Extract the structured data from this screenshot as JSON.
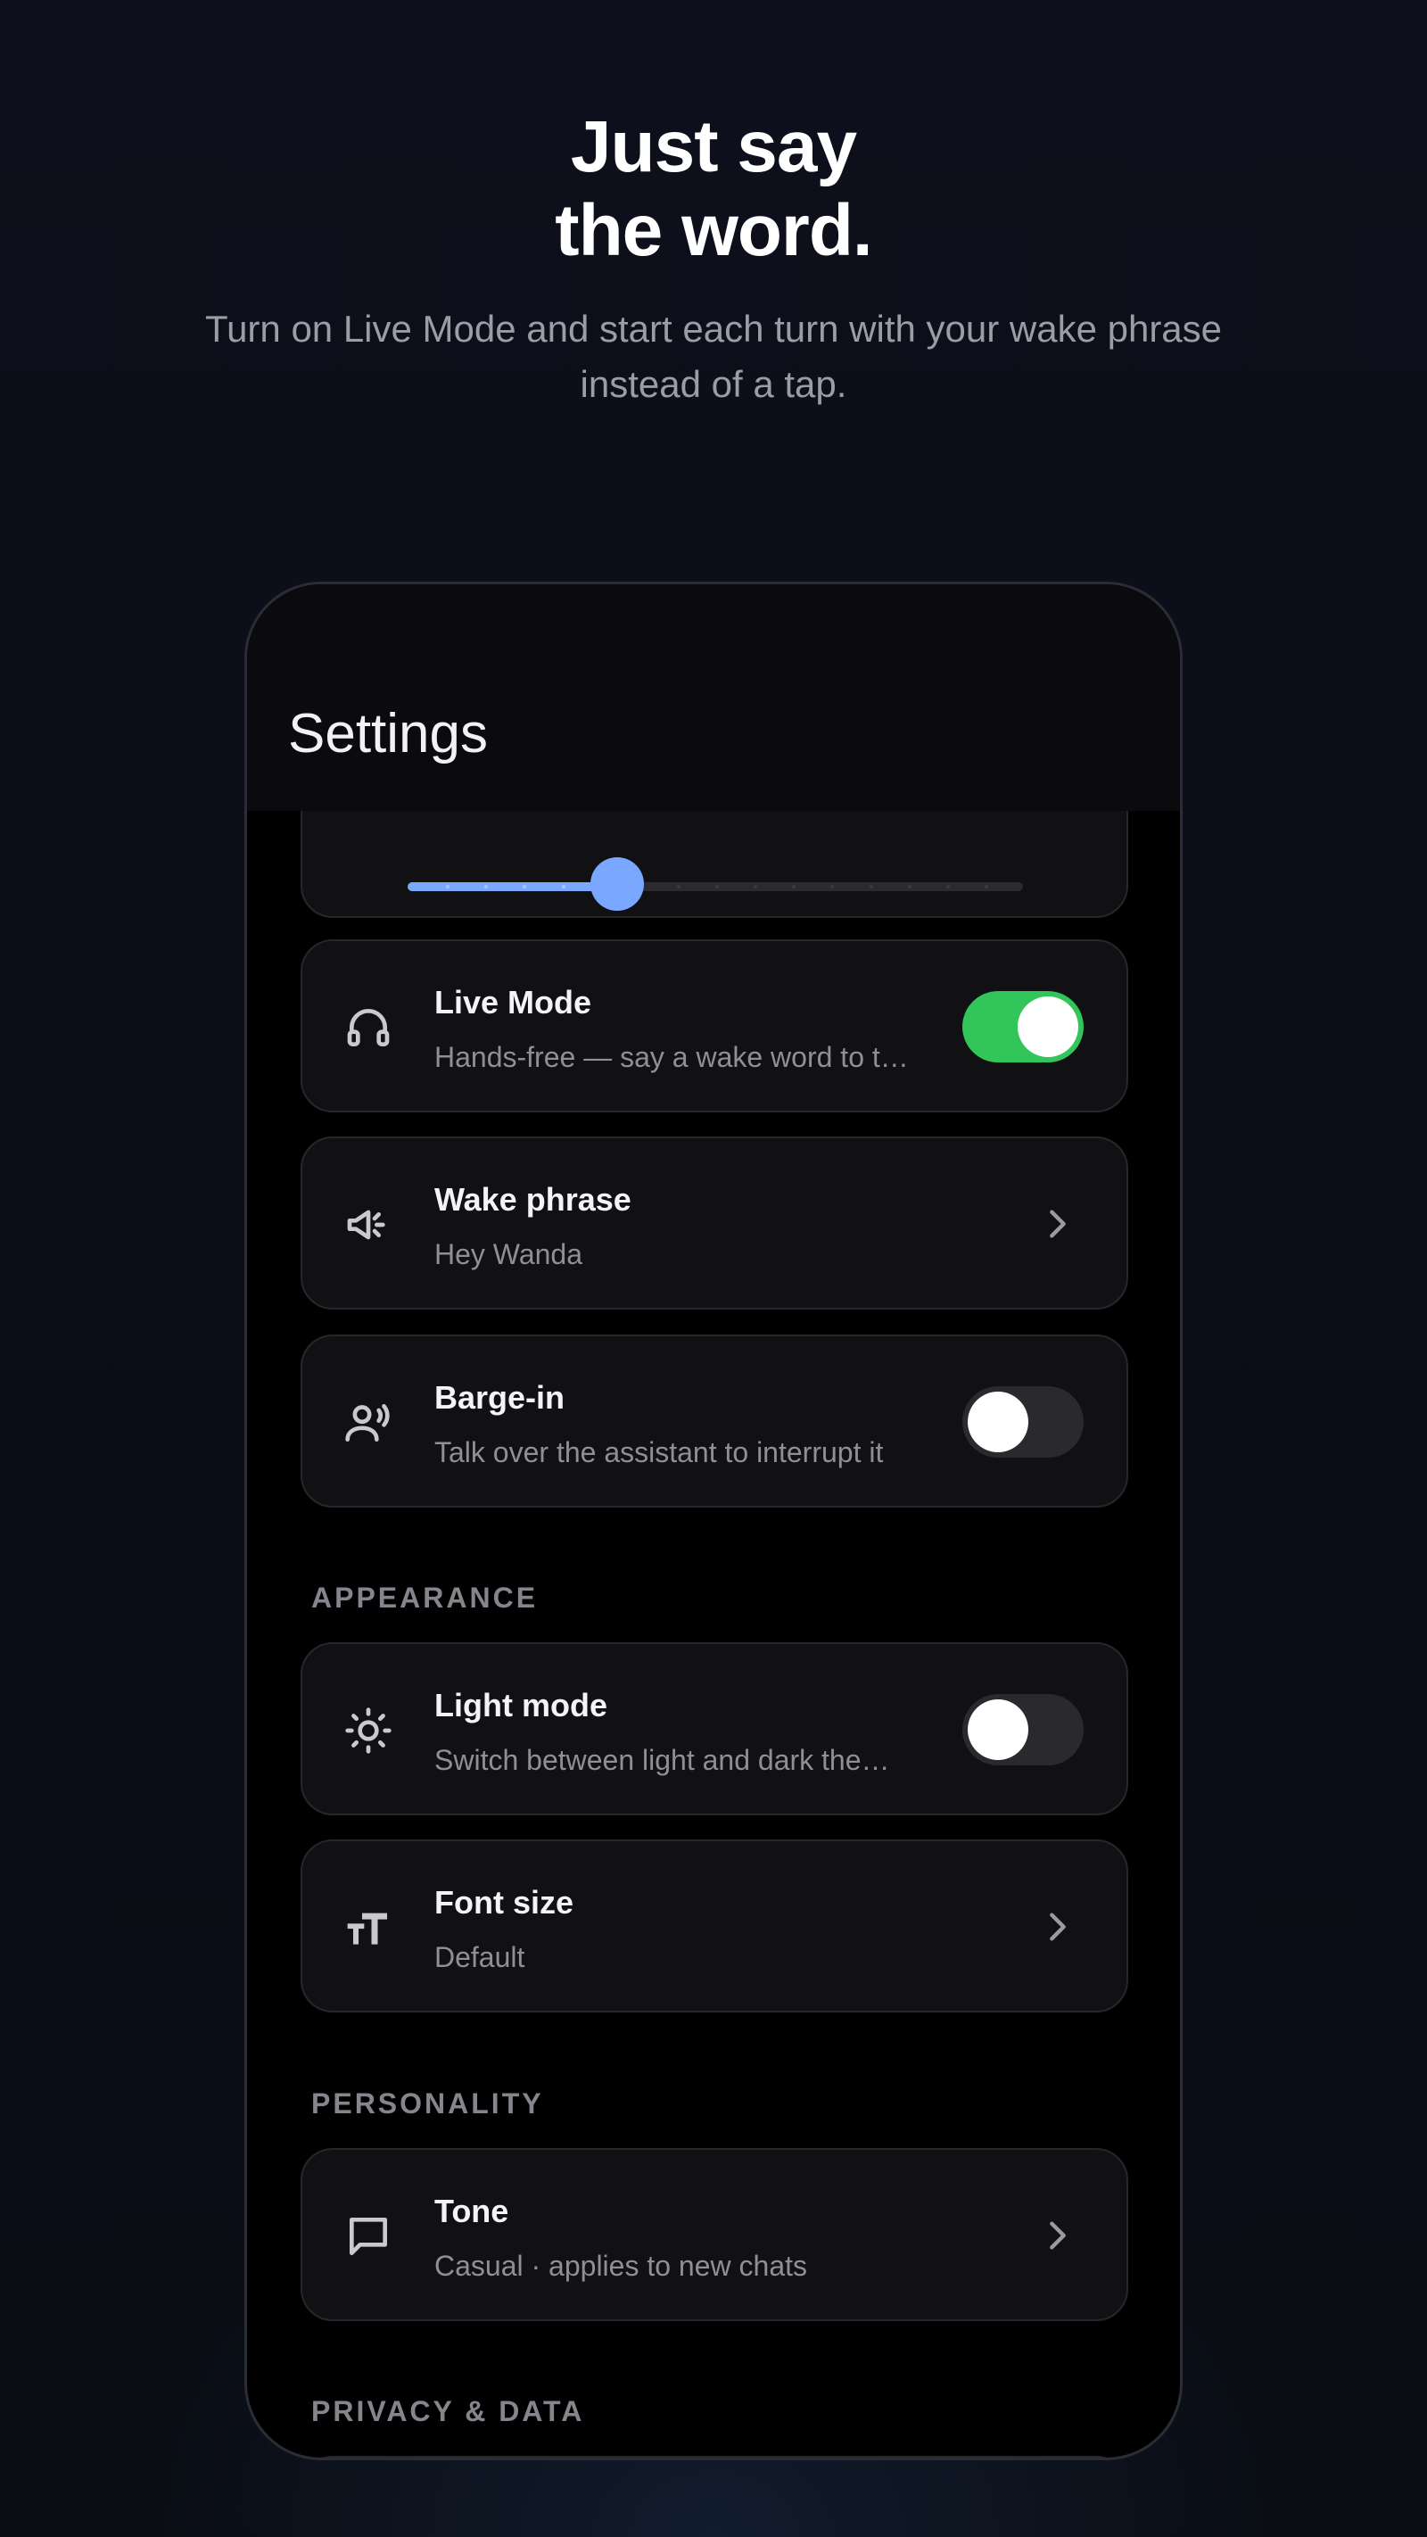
{
  "hero": {
    "title_line1": "Just say",
    "title_line2": "the word.",
    "subtitle": "Turn on Live Mode and start each turn with your wake phrase instead of a tap."
  },
  "screen": {
    "title": "Settings",
    "slider": {
      "value_fraction": 0.34
    },
    "settings": [
      {
        "label": "Live Mode",
        "sub": "Hands-free — say a wake word to t…",
        "icon": "headphones-icon",
        "control": "toggle",
        "on": true
      },
      {
        "label": "Wake phrase",
        "sub": "Hey Wanda",
        "icon": "megaphone-icon",
        "control": "chevron"
      },
      {
        "label": "Barge-in",
        "sub": "Talk over the assistant to interrupt it",
        "icon": "voice-person-icon",
        "control": "toggle",
        "on": false
      }
    ],
    "sections": {
      "appearance": "APPEARANCE",
      "personality": "PERSONALITY",
      "privacy": "PRIVACY & DATA"
    },
    "appearance_items": [
      {
        "label": "Light mode",
        "sub": "Switch between light and dark the…",
        "icon": "sun-icon",
        "control": "toggle",
        "on": false
      },
      {
        "label": "Font size",
        "sub": "Default",
        "icon": "text-size-icon",
        "control": "chevron"
      }
    ],
    "personality_items": [
      {
        "label": "Tone",
        "sub": "Casual · applies to new chats",
        "icon": "chat-bubble-icon",
        "control": "chevron"
      }
    ]
  },
  "colors": {
    "accent": "#7aa7ff",
    "toggle_on": "#31c55a",
    "background": "#0c0e18"
  }
}
